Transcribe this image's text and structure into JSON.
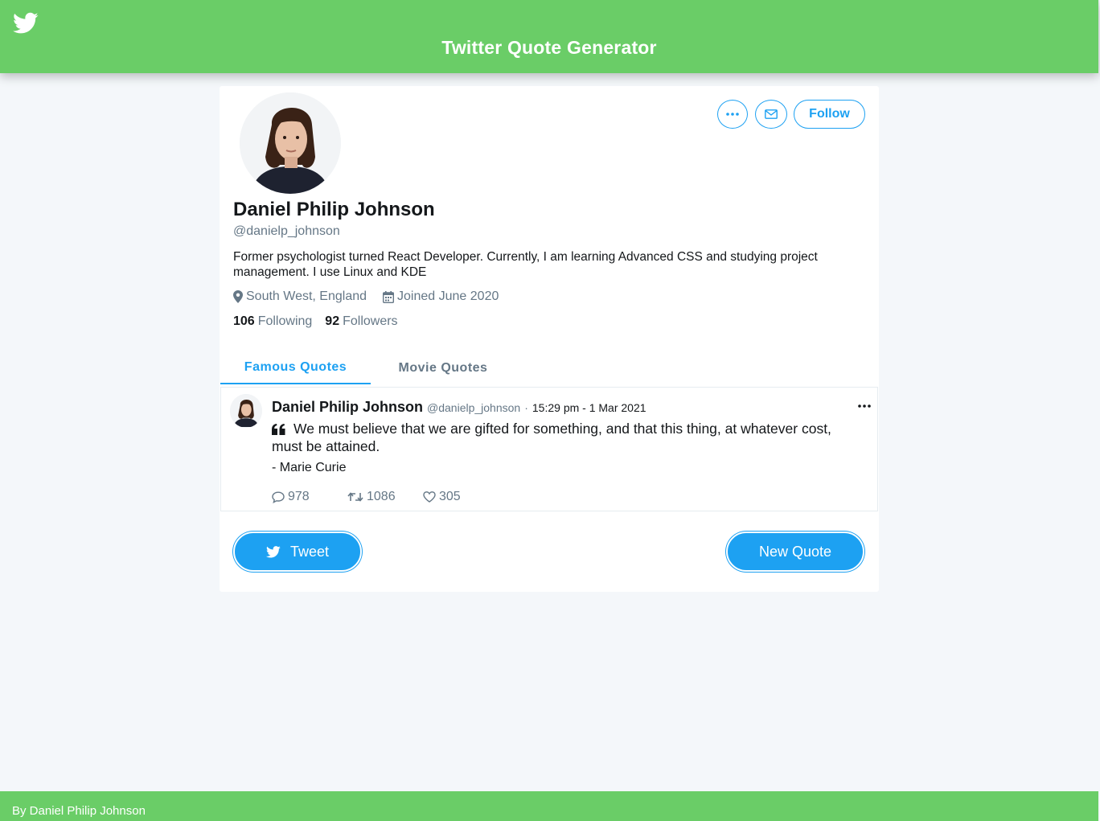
{
  "header": {
    "title": "Twitter Quote Generator",
    "icon": "twitter-bird-icon"
  },
  "profile": {
    "name": "Daniel Philip Johnson",
    "handle": "@danielp_johnson",
    "bio": "Former psychologist turned React Developer. Currently, I am learning Advanced CSS and studying project management. I use Linux and KDE",
    "location": "South West, England",
    "joined": "Joined June 2020",
    "following_count": "106",
    "following_label": "Following",
    "followers_count": "92",
    "followers_label": "Followers",
    "follow_label": "Follow"
  },
  "tabs": [
    {
      "label": "Famous Quotes",
      "active": true
    },
    {
      "label": "Movie Quotes",
      "active": false
    }
  ],
  "tweet": {
    "name": "Daniel Philip Johnson",
    "handle": "@danielp_johnson",
    "separator": "·",
    "time": "15:29 pm - 1 Mar 2021",
    "quote": "We must believe that we are gifted for something, and that this thing, at whatever cost, must be attained.",
    "author": "- Marie Curie",
    "replies": "978",
    "retweets": "1086",
    "likes": "305"
  },
  "actions": {
    "tweet_label": "Tweet",
    "new_quote_label": "New Quote"
  },
  "footer": {
    "text": "By Daniel Philip Johnson"
  },
  "colors": {
    "header_green": "#6acd67",
    "accent_blue": "#1da1f2",
    "muted": "#657786"
  }
}
